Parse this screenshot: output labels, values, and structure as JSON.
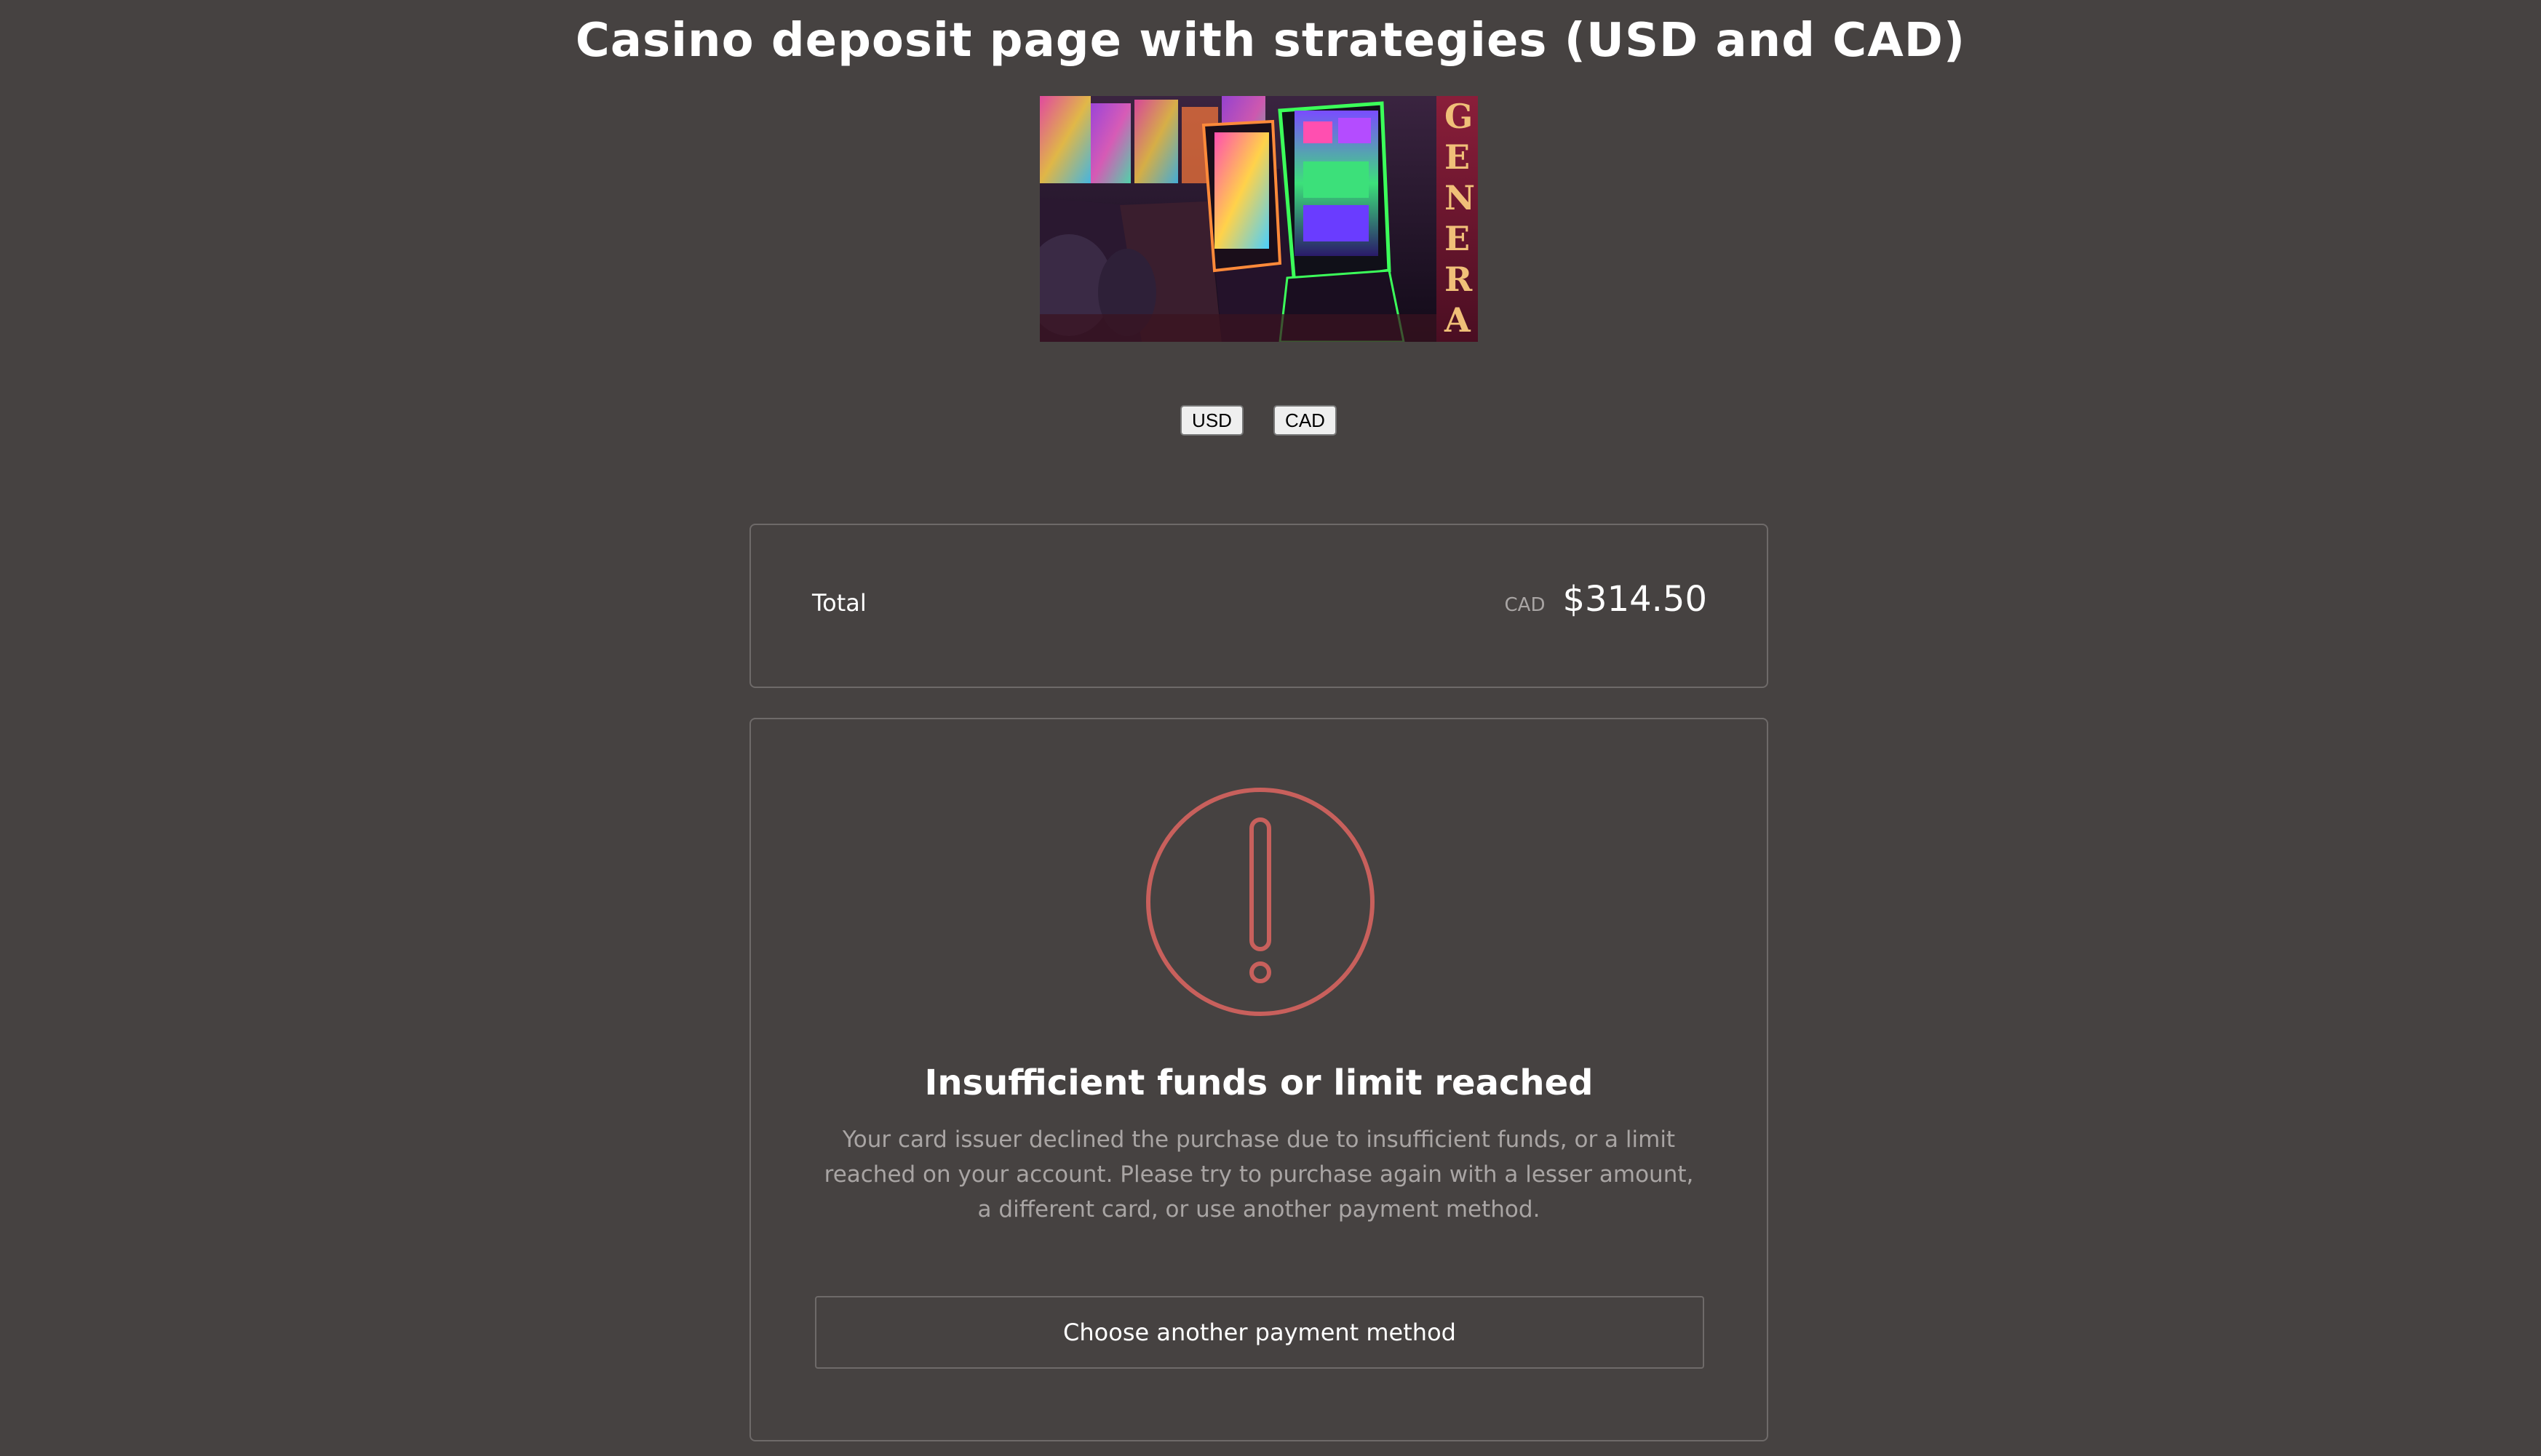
{
  "page": {
    "title": "Casino deposit page with strategies (USD and CAD)"
  },
  "hero": {
    "image_name": "slot-machines-image",
    "sign_text": "GENERA"
  },
  "currency": {
    "options": [
      "USD",
      "CAD"
    ],
    "usd_label": "USD",
    "cad_label": "CAD"
  },
  "total": {
    "label": "Total",
    "currency": "CAD",
    "amount": "$314.50"
  },
  "error": {
    "icon": "alert-circle-icon",
    "title": "Insufficient funds or limit reached",
    "message": "Your card issuer declined the purchase due to insufficient funds, or a limit reached on your account. Please try to purchase again with a lesser amount, a different card, or use another payment method.",
    "button_label": "Choose another payment method"
  },
  "colors": {
    "background": "#464241",
    "card_border": "#6e6a69",
    "alert": "#c8605c",
    "muted_text": "#a9a5a4"
  }
}
